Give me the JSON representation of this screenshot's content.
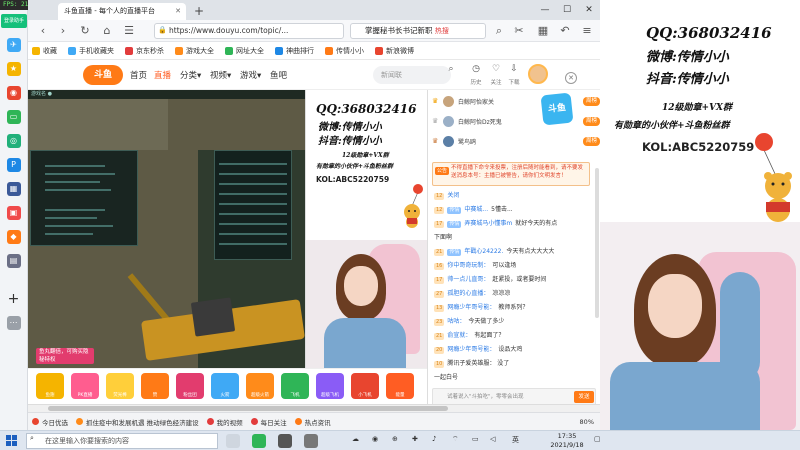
{
  "overlay": {
    "text": "FPS: 218   Ping:          Time: 17:35"
  },
  "browser": {
    "tab_title": "斗鱼直播 - 每个人的直播平台",
    "url": "https://www.douyu.com/topic/...",
    "search_text": "掌握秘书长书记新职",
    "search_hot": "热搜",
    "bookmarks": [
      "收藏",
      "手机收藏夹",
      "京东秒杀",
      "游戏大全",
      "网址大全",
      "神曲排行",
      "传情小小",
      "新浪微博"
    ],
    "zoom": "80%"
  },
  "sidebar": {
    "badge": "登录助手"
  },
  "site": {
    "logo": "斗鱼",
    "nav": [
      "首页",
      "直播",
      "分类▾",
      "视频▾",
      "游戏▾",
      "鱼吧"
    ],
    "search_placeholder": "新闻联",
    "header_icons": [
      "历史",
      "关注",
      "下载"
    ]
  },
  "game": {
    "caption": "游戏名  ●",
    "promo": "鱼丸翻倍，可购买隐秘特权",
    "colors": {
      "gun": "#c99322"
    }
  },
  "streamer_card": {
    "qq": "QQ:368032416",
    "weibo": "微博:传情小小",
    "douyin": "抖音:传情小小",
    "group1": "12级勋章+VX群",
    "group2": "有勋章的小伙伴+斗鱼粉丝群",
    "kol": "KOL:ABC5220759"
  },
  "chat": {
    "ranks": [
      {
        "name": "白鲸阿怡家关",
        "badge": "周榜"
      },
      {
        "name": "白鲸阿怡Dz死鬼",
        "badge": "周榜"
      },
      {
        "name": "鹭鸟鸥",
        "badge": "周榜"
      }
    ],
    "logo": "斗鱼",
    "notice_tag": "公告",
    "notice": "不得直播下命令来投票，注册后随时能看到，请不要发送消息本号：主播已被警告，请你们文明发言！",
    "messages": [
      {
        "level": "12",
        "fan": "",
        "nick": "关闭",
        "text": ""
      },
      {
        "level": "12",
        "fan": "传情",
        "nick": "中赛城...",
        "text": "5懂击..."
      },
      {
        "level": "17",
        "fan": "传情",
        "nick": "弄赛城马小懂事m",
        "text": "就好今天的有点"
      },
      {
        "level": "",
        "fan": "",
        "nick": "",
        "text": "下面啊"
      },
      {
        "level": "21",
        "fan": "传情",
        "nick": "年戳心24222.",
        "text": "今天有点大大大大"
      },
      {
        "level": "16",
        "fan": "",
        "nick": "你中哥奇玩制：",
        "text": "可以逢场"
      },
      {
        "level": "17",
        "fan": "",
        "nick": "帅一点儿直哥：",
        "text": "赶紧投，或者要时间"
      },
      {
        "level": "27",
        "fan": "",
        "nick": "孤胆的心直播：",
        "text": "凉凉凉"
      },
      {
        "level": "13",
        "fan": "",
        "nick": "网瘾少年哥号能：",
        "text": "教师系列？"
      },
      {
        "level": "23",
        "fan": "",
        "nick": "咕咕：",
        "text": "今天做了多少"
      },
      {
        "level": "21",
        "fan": "",
        "nick": "俞宣就：",
        "text": "有起面了？"
      },
      {
        "level": "20",
        "fan": "",
        "nick": "网瘾少年哥号能：",
        "text": "设品大鸡"
      },
      {
        "level": "10",
        "fan": "",
        "nick": "",
        "text": "腾讯子爱英雄服：    没了"
      },
      {
        "level": "",
        "fan": "",
        "nick": "",
        "text": "一起白号"
      }
    ],
    "input_placeholder": "试着说入\"斗拍吃\"，零零会出现",
    "send": "发送"
  },
  "gifts": [
    "鱼翅",
    "PK直播",
    "荧光棒",
    "赞",
    "粉丝团",
    "火箭",
    "超级火箭",
    "飞机",
    "超级飞机",
    "小飞机",
    "能量"
  ],
  "statusbar": {
    "items": [
      "今日优选",
      "抓住疫中和发展机遇 推动绿色经济建设",
      "我的视频",
      "每日关注",
      "热点资讯"
    ]
  },
  "right_overlay": {
    "qq": "QQ:368032416",
    "weibo": "微博:传情小小",
    "douyin": "抖音:传情小小",
    "group1": "12级勋章+VX群",
    "group2": "有勋章的小伙伴+斗鱼粉丝群",
    "kol": "KOL:ABC5220759"
  },
  "taskbar": {
    "search_placeholder": "在这里输入你要搜索的内容",
    "time": "17:35",
    "date": "2021/9/18",
    "lang": "英"
  }
}
